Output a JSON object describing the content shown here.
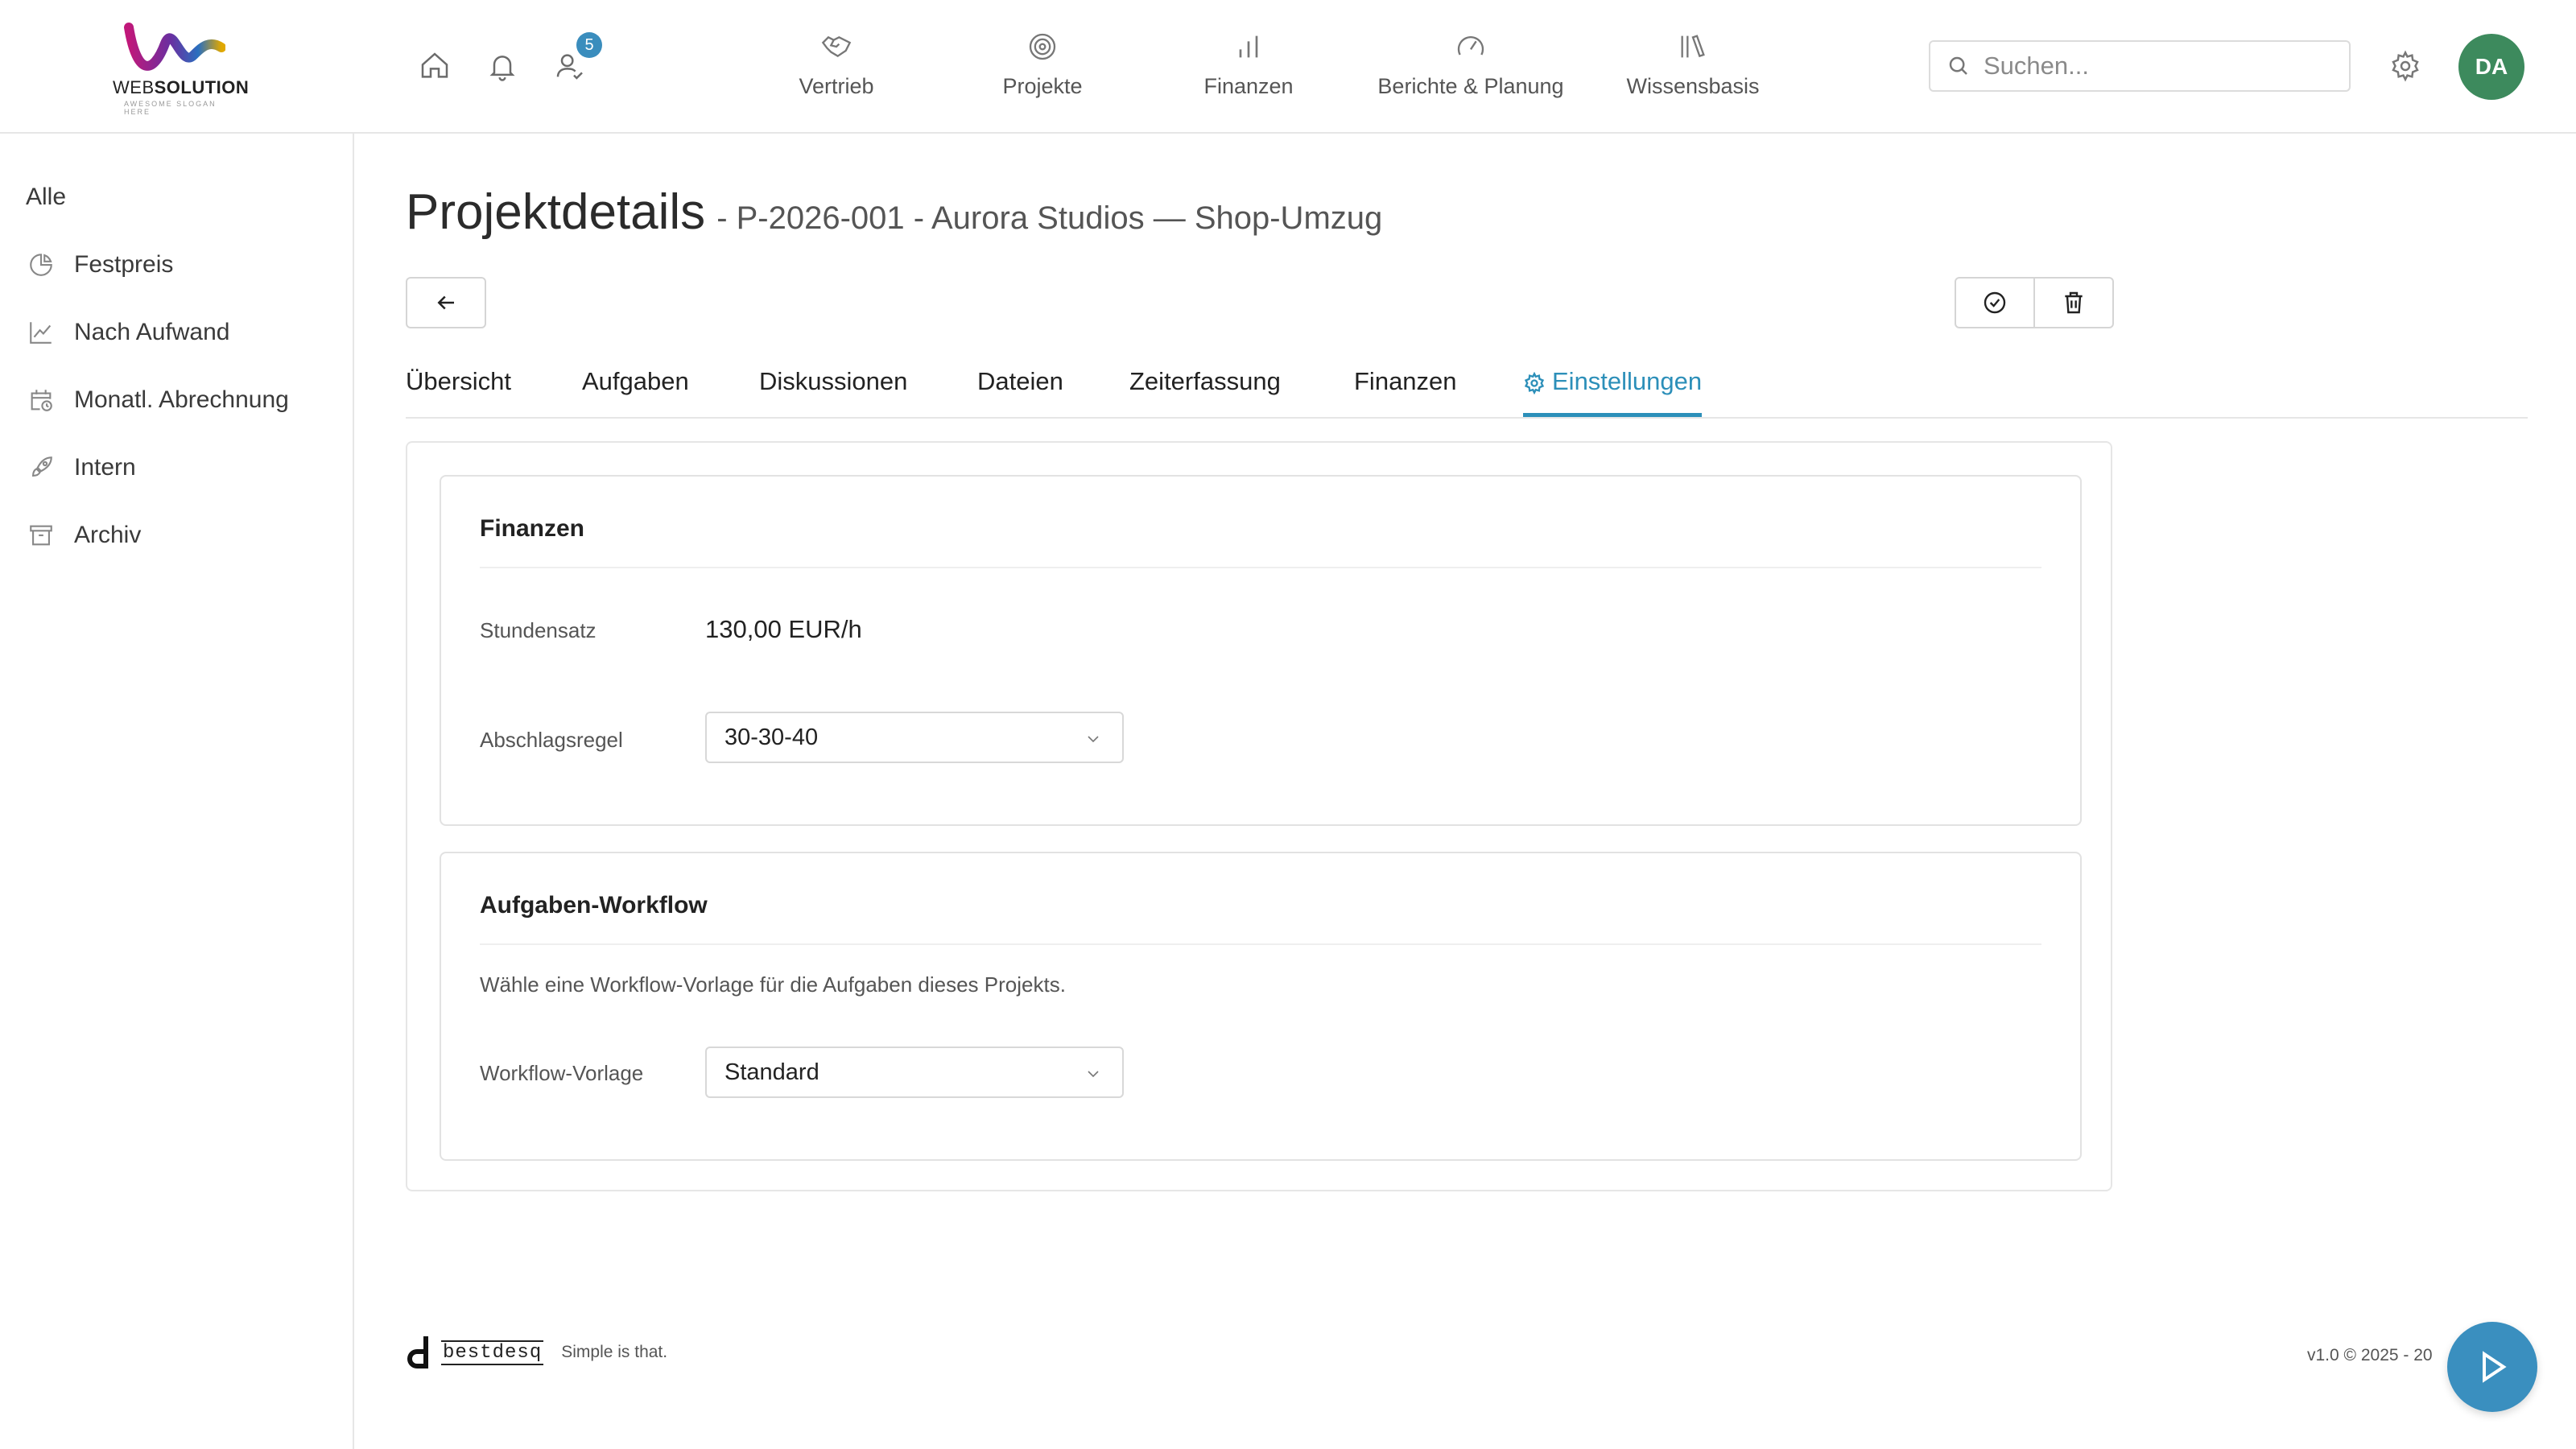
{
  "header": {
    "logo": {
      "brand_bold": "SOLUTION",
      "brand_light": "WEB",
      "slogan": "AWESOME SLOGAN HERE"
    },
    "notifications_badge": "5",
    "nav": [
      {
        "label": "Vertrieb",
        "icon": "handshake-icon"
      },
      {
        "label": "Projekte",
        "icon": "target-icon"
      },
      {
        "label": "Finanzen",
        "icon": "bar-chart-icon"
      },
      {
        "label": "Berichte & Planung",
        "icon": "gauge-icon"
      },
      {
        "label": "Wissensbasis",
        "icon": "books-icon"
      }
    ],
    "search": {
      "placeholder": "Suchen..."
    },
    "avatar_initials": "DA"
  },
  "sidebar": {
    "items": [
      {
        "label": "Alle"
      },
      {
        "label": "Festpreis",
        "icon": "pie-chart-icon"
      },
      {
        "label": "Nach Aufwand",
        "icon": "line-chart-icon"
      },
      {
        "label": "Monatl. Abrechnung",
        "icon": "calendar-clock-icon"
      },
      {
        "label": "Intern",
        "icon": "rocket-icon"
      },
      {
        "label": "Archiv",
        "icon": "archive-icon"
      }
    ]
  },
  "page": {
    "title": "Projektdetails",
    "subtitle": "- P-2026-001 - Aurora Studios — Shop-Umzug"
  },
  "tabs": [
    {
      "label": "Übersicht"
    },
    {
      "label": "Aufgaben"
    },
    {
      "label": "Diskussionen"
    },
    {
      "label": "Dateien"
    },
    {
      "label": "Zeiterfassung"
    },
    {
      "label": "Finanzen"
    },
    {
      "label": "Einstellungen",
      "active": true
    }
  ],
  "finance_card": {
    "title": "Finanzen",
    "hourly_rate_label": "Stundensatz",
    "hourly_rate_value": "130,00 EUR/h",
    "payment_rule_label": "Abschlagsregel",
    "payment_rule_value": "30-30-40"
  },
  "workflow_card": {
    "title": "Aufgaben-Workflow",
    "description": "Wähle eine Workflow-Vorlage für die Aufgaben dieses Projekts.",
    "template_label": "Workflow-Vorlage",
    "template_value": "Standard"
  },
  "footer": {
    "brand": "bestdesq",
    "tagline": "Simple is that.",
    "version": "v1.0 © 2025 - 20"
  },
  "colors": {
    "accent": "#2c8fb9",
    "avatar": "#3d8a5d",
    "fab": "#3a8fbf"
  }
}
